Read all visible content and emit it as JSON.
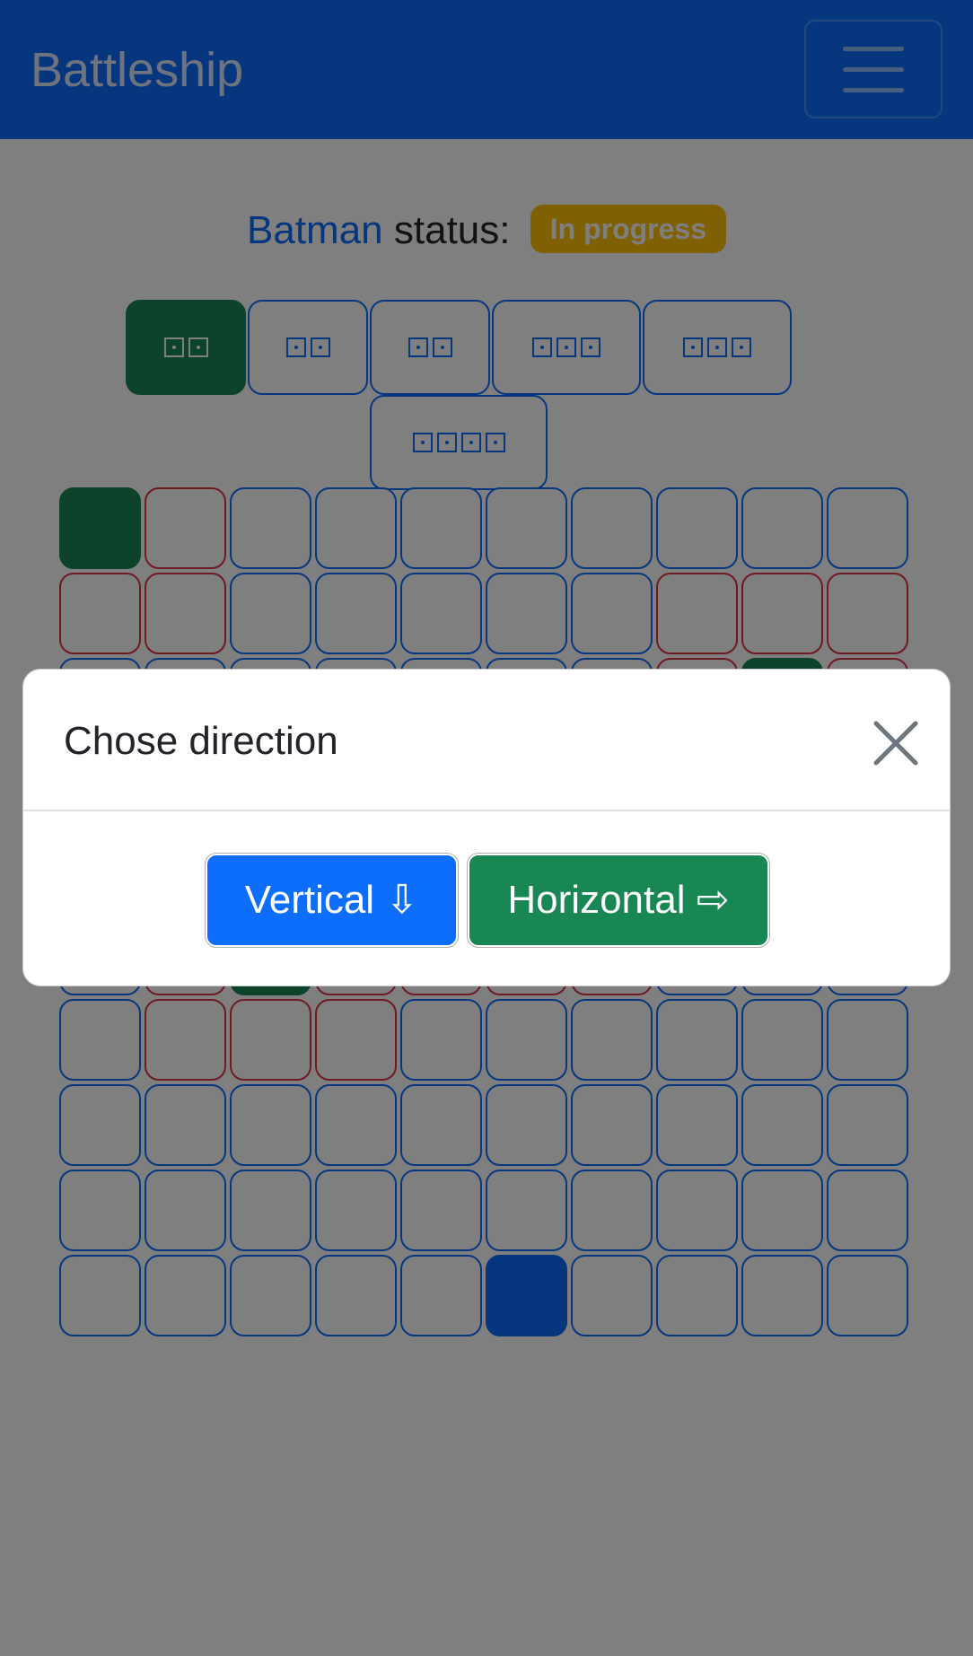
{
  "app": {
    "brand": "Battleship"
  },
  "status": {
    "player": "Batman",
    "label": "status:",
    "badge": "In progress"
  },
  "ships": [
    {
      "size": 2,
      "selected": true
    },
    {
      "size": 2,
      "selected": false
    },
    {
      "size": 2,
      "selected": false
    },
    {
      "size": 3,
      "selected": false
    },
    {
      "size": 3,
      "selected": false
    },
    {
      "size": 4,
      "selected": false
    }
  ],
  "board": {
    "size": 10,
    "rows": [
      [
        "ship",
        "miss",
        "",
        "",
        "",
        "",
        "",
        "",
        "",
        ""
      ],
      [
        "miss",
        "miss",
        "",
        "",
        "",
        "",
        "",
        "miss",
        "miss",
        "miss"
      ],
      [
        "",
        "",
        "",
        "",
        "",
        "",
        "",
        "miss",
        "ship",
        "miss"
      ],
      [
        "",
        "",
        "",
        "",
        "",
        "",
        "",
        "",
        "",
        ""
      ],
      [
        "",
        "",
        "",
        "",
        "",
        "",
        "",
        "",
        "",
        ""
      ],
      [
        "",
        "miss",
        "ship",
        "miss",
        "miss",
        "miss",
        "miss",
        "",
        "",
        ""
      ],
      [
        "",
        "miss",
        "miss",
        "miss",
        "",
        "",
        "",
        "",
        "",
        ""
      ],
      [
        "",
        "",
        "",
        "",
        "",
        "",
        "",
        "",
        "",
        ""
      ],
      [
        "",
        "",
        "",
        "",
        "",
        "",
        "",
        "",
        "",
        ""
      ],
      [
        "",
        "",
        "",
        "",
        "",
        "target",
        "",
        "",
        "",
        ""
      ]
    ]
  },
  "modal": {
    "title": "Chose direction",
    "vertical_label": "Vertical",
    "vertical_arrow": "⇩",
    "horizontal_label": "Horizontal",
    "horizontal_arrow": "⇨"
  },
  "colors": {
    "primary": "#0d6efd",
    "success": "#198754",
    "danger": "#dc3545",
    "warning": "#ffc107"
  }
}
